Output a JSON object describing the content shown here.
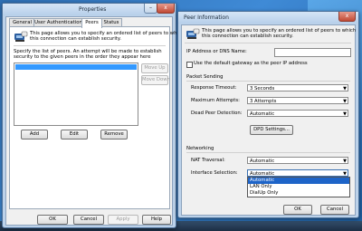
{
  "properties": {
    "title": "Properties",
    "min": "–",
    "close": "x",
    "tabs": [
      "General",
      "User Authentication",
      "Peers",
      "Status"
    ],
    "intro": [
      "This page allows you to specify an ordered list of peers to which",
      "this connection can establish security."
    ],
    "desc": [
      "Specify the list of peers. An attempt will be made to establish",
      "security to the given peers in the order they appear here"
    ],
    "move_up": "Move Up",
    "move_down": "Move Down",
    "add": "Add",
    "edit": "Edit",
    "remove": "Remove",
    "ok": "OK",
    "cancel": "Cancel",
    "apply": "Apply",
    "help": "Help"
  },
  "peer": {
    "title": "Peer Information",
    "close": "x",
    "intro": [
      "This page allows you to specify an ordered list of peers to which",
      "this connection can establish security."
    ],
    "ip_label": "IP Address or DNS Name:",
    "ip_value": "",
    "default_gw": "Use the default gateway as the peer IP address",
    "packet_sending": "Packet Sending",
    "response_timeout_label": "Response Timeout:",
    "response_timeout_value": "3 Seconds",
    "max_attempts_label": "Maximum Attempts:",
    "max_attempts_value": "3 Attempts",
    "dpd_label": "Dead Peer Detection:",
    "dpd_value": "Automatic",
    "dpd_settings": "DPD Settings...",
    "networking": "Networking",
    "nat_label": "NAT Traversal:",
    "nat_value": "Automatic",
    "iface_label": "Interface Selection:",
    "iface_value": "Automatic",
    "iface_options": [
      "Automatic",
      "LAN Only",
      "DialUp Only"
    ],
    "ok": "OK",
    "cancel": "Cancel"
  },
  "colors": {
    "selection": "#3399ff",
    "dropdown_highlight": "#1e64c8"
  }
}
